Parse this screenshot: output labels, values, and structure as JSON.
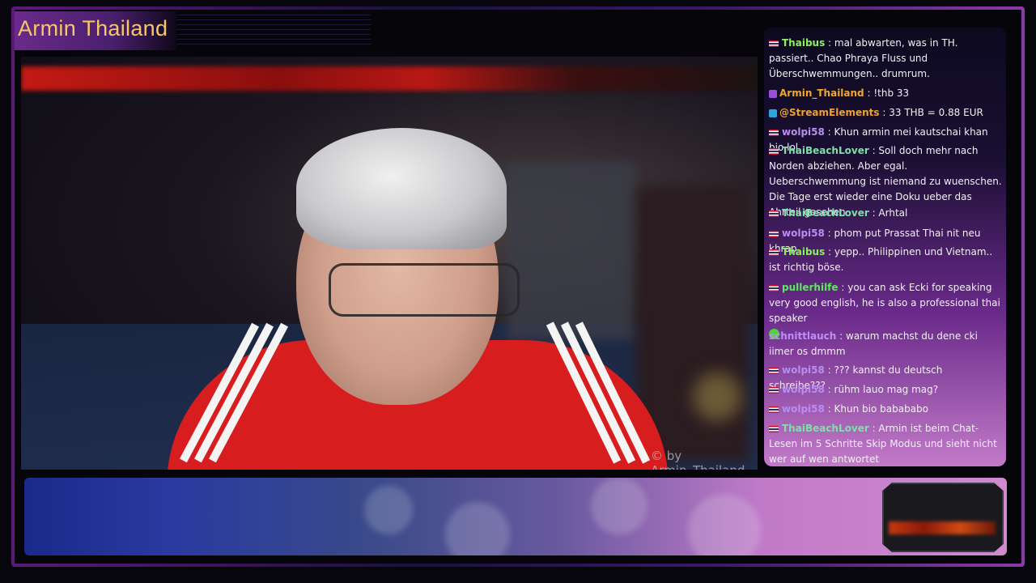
{
  "overlay": {
    "title": "Armin Thailand",
    "watermark": "© by Armin_Thailand"
  },
  "chat": {
    "messages": [
      {
        "user": "Thaibus",
        "color": "#8ef060",
        "text": "mal abwarten, was in TH. passiert.. Chao Phraya Fluss und Überschwemmungen.. drumrum.",
        "badge": "flag-icon"
      },
      {
        "user": "Armin_Thailand",
        "color": "#f0a830",
        "text": "!thb 33",
        "badge": "broadcaster-icon"
      },
      {
        "user": "@StreamElements",
        "color": "#f0a030",
        "text": "33 THB = 0.88 EUR",
        "badge": "bot-icon"
      },
      {
        "user": "wolpi58",
        "color": "#b98ef0",
        "text": "Khun armin mei kautschai khan bio lol",
        "badge": "flag-icon"
      },
      {
        "user": "ThaiBeachLover",
        "color": "#7ee0a8",
        "text": "Soll doch mehr nach Norden abziehen. Aber egal. Ueberschwemmung ist niemand zu wuenschen. Die Tage erst wieder eine Doku ueber das Ahrteil gesehen",
        "badge": "flag-icon"
      },
      {
        "user": "ThaiBeachLover",
        "color": "#7ee0a8",
        "text": "Arhtal",
        "badge": "flag-icon"
      },
      {
        "user": "wolpi58",
        "color": "#b98ef0",
        "text": "phom put Prassat Thai nit neu khrap",
        "badge": "flag-icon"
      },
      {
        "user": "Thaibus",
        "color": "#8ef060",
        "text": "yepp.. Philippinen und Vietnam.. ist richtig böse.",
        "badge": "flag-icon"
      },
      {
        "user": "pullerhilfe",
        "color": "#5ee85e",
        "text": "you can ask Ecki for speaking very good english, he is also a professional thai speaker",
        "badge": "flag-icon"
      },
      {
        "user": "schnittlauch",
        "color": "#c08ef8",
        "text": "warum machst du dene cki iimer os dmmm",
        "badge": "none"
      },
      {
        "user": "wolpi58",
        "color": "#b98ef0",
        "text": "??? kannst du deutsch schreibe???",
        "badge": "flag-icon"
      },
      {
        "user": "wolpi58",
        "color": "#b98ef0",
        "text": "rühm lauo mag mag?",
        "badge": "flag-icon"
      },
      {
        "user": "wolpi58",
        "color": "#b98ef0",
        "text": "Khun bio babababo",
        "badge": "flag-icon"
      },
      {
        "user": "ThaiBeachLover",
        "color": "#7ee0a8",
        "text": "Armin ist beim Chat-Lesen im 5 Schritte Skip Modus und sieht nicht wer auf wen antwortet",
        "badge": "flag-icon"
      }
    ]
  }
}
